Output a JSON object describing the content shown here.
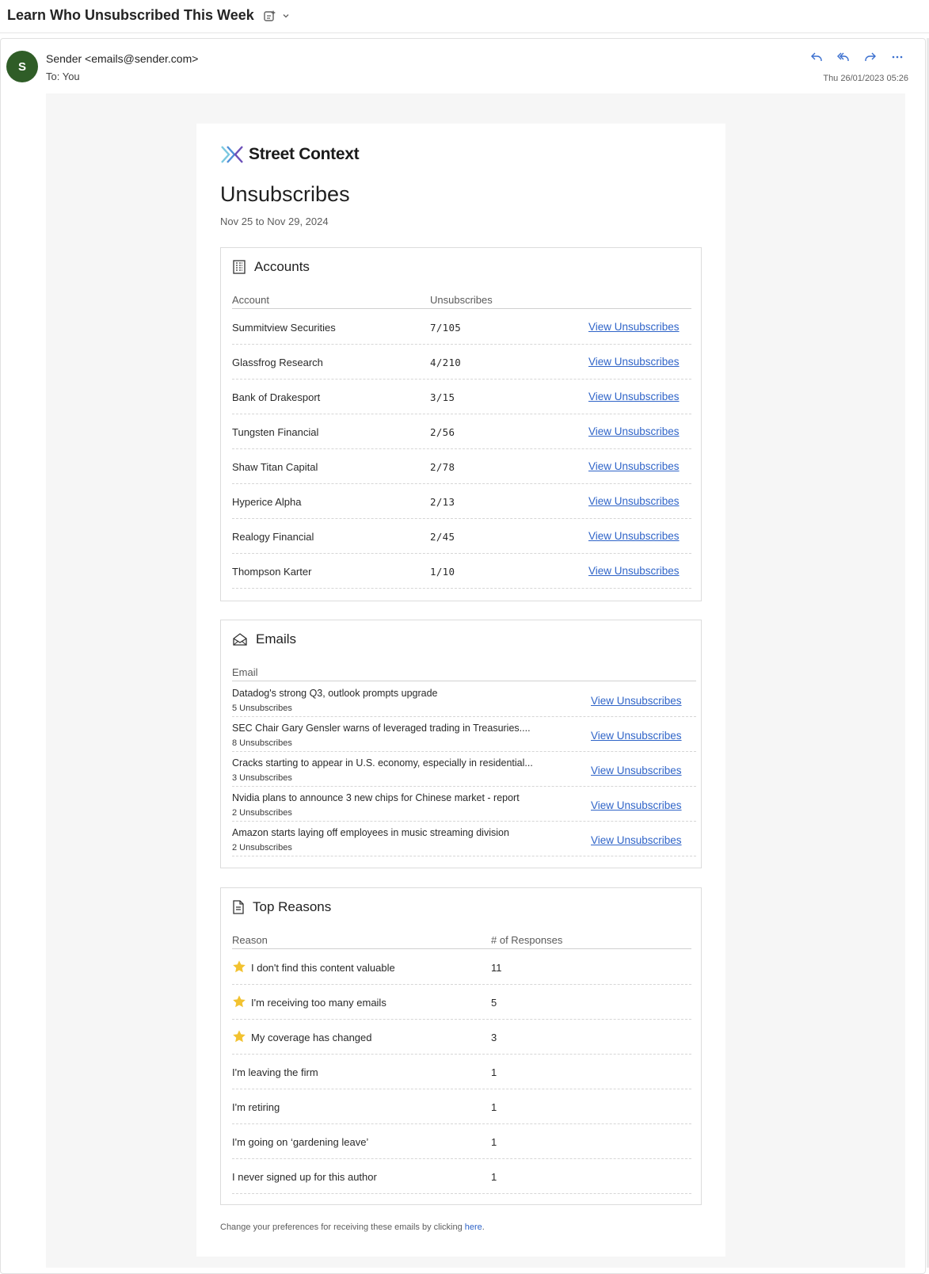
{
  "subject": {
    "title": "Learn Who Unsubscribed This Week"
  },
  "message": {
    "avatar_letter": "S",
    "sender": "Sender <emails@sender.com>",
    "to": "To:  You",
    "date": "Thu 26/01/2023 05:26"
  },
  "email": {
    "brand": "Street Context",
    "title": "Unsubscribes",
    "date_range": "Nov 25 to Nov 29, 2024",
    "accounts": {
      "heading": "Accounts",
      "col_account": "Account",
      "col_unsubscribes": "Unsubscribes",
      "link_label": "View Unsubscribes",
      "rows": [
        {
          "name": "Summitview Securities",
          "count": "7/105"
        },
        {
          "name": "Glassfrog Research",
          "count": "4/210"
        },
        {
          "name": "Bank of Drakesport",
          "count": "3/15"
        },
        {
          "name": "Tungsten Financial",
          "count": "2/56"
        },
        {
          "name": "Shaw Titan Capital",
          "count": "2/78"
        },
        {
          "name": "Hyperice Alpha",
          "count": "2/13"
        },
        {
          "name": "Realogy Financial",
          "count": "2/45"
        },
        {
          "name": "Thompson Karter",
          "count": "1/10"
        }
      ]
    },
    "emails": {
      "heading": "Emails",
      "col_email": "Email",
      "link_label": "View Unsubscribes",
      "rows": [
        {
          "title": "Datadog's strong Q3, outlook prompts upgrade",
          "count": "5 Unsubscribes"
        },
        {
          "title": "SEC Chair Gary Gensler warns of leveraged trading in Treasuries....",
          "count": "8 Unsubscribes"
        },
        {
          "title": "Cracks starting to appear in U.S. economy, especially in residential...",
          "count": "3 Unsubscribes"
        },
        {
          "title": "Nvidia plans to announce 3 new chips for Chinese market - report",
          "count": "2 Unsubscribes"
        },
        {
          "title": "Amazon starts laying off employees in music streaming division",
          "count": "2 Unsubscribes"
        }
      ]
    },
    "reasons": {
      "heading": "Top Reasons",
      "col_reason": "Reason",
      "col_responses": "# of Responses",
      "rows": [
        {
          "reason": "I don't find this content valuable",
          "responses": "11",
          "starred": true
        },
        {
          "reason": "I'm receiving too many emails",
          "responses": "5",
          "starred": true
        },
        {
          "reason": "My coverage has changed",
          "responses": "3",
          "starred": true
        },
        {
          "reason": "I'm leaving the firm",
          "responses": "1",
          "starred": false
        },
        {
          "reason": "I'm retiring",
          "responses": "1",
          "starred": false
        },
        {
          "reason": "I'm going on ‘gardening leave’",
          "responses": "1",
          "starred": false
        },
        {
          "reason": "I never signed up for this author",
          "responses": "1",
          "starred": false
        }
      ]
    },
    "footer": {
      "text": "Change your preferences for receiving these emails by clicking ",
      "link": "here",
      "period": "."
    }
  },
  "colors": {
    "accent": "#2f64c8",
    "avatar": "#2f5d27",
    "star": "#f2c230"
  },
  "icons": {
    "subject_tools": [
      "summary-icon",
      "chevron-down-icon"
    ],
    "actions": [
      "reply-icon",
      "reply-all-icon",
      "forward-icon",
      "more-icon"
    ],
    "panels": [
      "building-icon",
      "envelope-open-icon",
      "document-icon"
    ],
    "reason_marker": "star-icon"
  }
}
